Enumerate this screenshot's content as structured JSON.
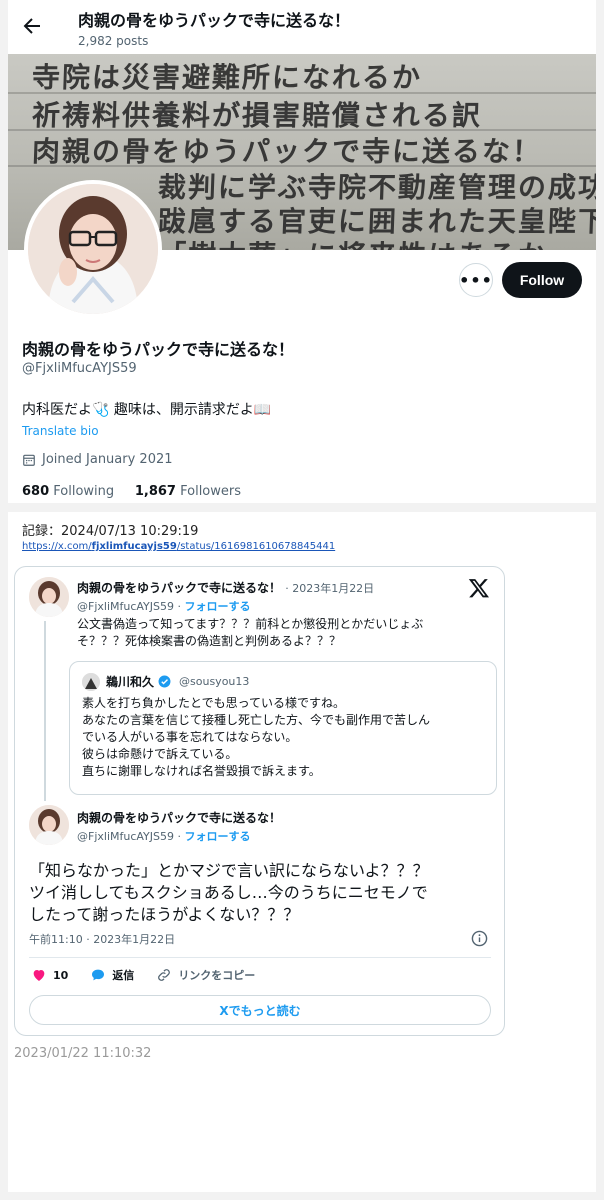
{
  "profile_header": {
    "title": "肉親の骨をゆうパックで寺に送るな！",
    "post_count": "2,982 posts"
  },
  "banner": {
    "lines": [
      "寺院は災害避難所になれるか",
      "祈祷料供養料が損害賠償される訳",
      "肉親の骨をゆうパックで寺に送るな！",
      "裁判に学ぶ寺院不動産管理の成功法",
      "跋扈する官吏に囲まれた天皇陛下",
      "「樹木葬」に将来性はあるか"
    ]
  },
  "profile": {
    "display_name": "肉親の骨をゆうパックで寺に送るな！",
    "handle": "@FjxliMfucAYJS59",
    "bio": "内科医だよ🩺 趣味は、開示請求だよ📖",
    "translate_label": "Translate bio",
    "joined": "Joined January 2021",
    "following_count": "680",
    "following_label": "Following",
    "followers_count": "1,867",
    "followers_label": "Followers",
    "follow_button": "Follow"
  },
  "archive": {
    "record_label": "記録：2024/07/13 10:29:19",
    "url_prefix": "https://x.com/",
    "url_user": "fjxlimfucayjs59",
    "url_suffix": "/status/1616981610678845441",
    "timestamp_footer": "2023/01/22 11:10:32"
  },
  "tweet_parent": {
    "name": "肉親の骨をゆうパックで寺に送るな！",
    "date": "· 2023年1月22日",
    "handle": "@FjxliMfucAYJS59",
    "follow_label": "フォローする",
    "lines": [
      "公文書偽造って知ってます？？？前科とか懲役刑とかだいじょぶ",
      "そ？？？死体検案書の偽造割と判例あるよ？？？"
    ]
  },
  "quoted_tweet": {
    "name": "鵜川和久",
    "handle": "@sousyou13",
    "lines": [
      "素人を打ち負かしたとでも思っている様ですね。",
      "あなたの言葉を信じて接種し死亡した方、今でも副作用で苦しん",
      "でいる人がいる事を忘れてはならない。",
      "彼らは命懸けで訴えている。",
      "直ちに謝罪しなければ名誉毀損で訴えます。"
    ]
  },
  "tweet_main": {
    "name": "肉親の骨をゆうパックで寺に送るな！",
    "handle": "@FjxliMfucAYJS59",
    "follow_label": "フォローする",
    "lines": [
      "「知らなかった」とかマジで言い訳にならないよ？？？",
      "ツイ消ししてもスクショあるし…今のうちにニセモノで",
      "したって謝ったほうがよくない？？？"
    ],
    "time": "午前11:10 · 2023年1月22日",
    "like_count": "10",
    "reply_label": "返信",
    "copy_link_label": "リンクをコピー",
    "read_more_label": "Xでもっと読む"
  },
  "colors": {
    "accent": "#1d9bf0",
    "like": "#f91880",
    "text": "#0f1419",
    "muted": "#536471"
  }
}
